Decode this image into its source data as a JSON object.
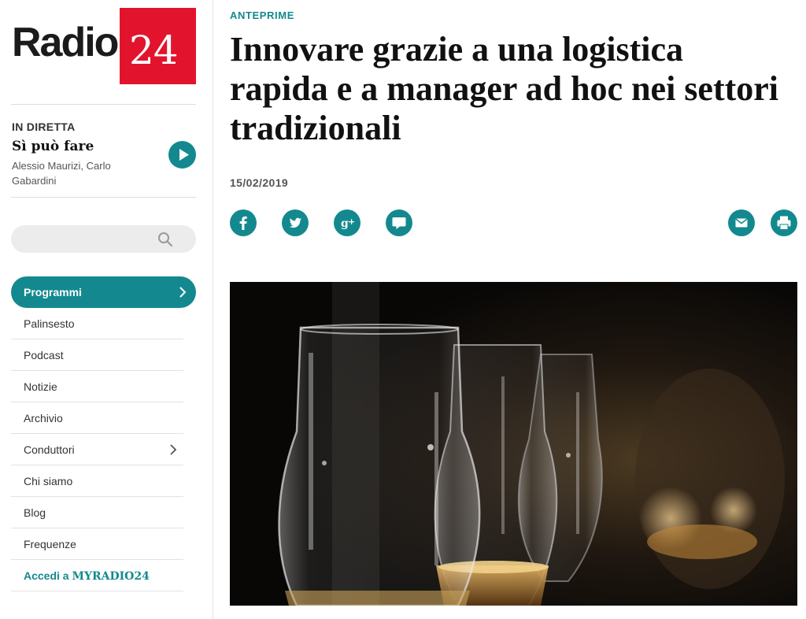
{
  "logo": {
    "word": "Radio",
    "number": "24"
  },
  "live": {
    "label": "IN DIRETTA",
    "show": "Sì può fare",
    "hosts": "Alessio Maurizi, Carlo Gabardini"
  },
  "search": {
    "placeholder": "",
    "icon": "search-icon"
  },
  "nav": {
    "items": [
      {
        "label": "Programmi"
      },
      {
        "label": "Palinsesto"
      },
      {
        "label": "Podcast"
      },
      {
        "label": "Notizie"
      },
      {
        "label": "Archivio"
      },
      {
        "label": "Conduttori"
      },
      {
        "label": "Chi siamo"
      },
      {
        "label": "Blog"
      },
      {
        "label": "Frequenze"
      }
    ],
    "account_prefix": "Accedi a ",
    "account_brand": "MYRADIO24"
  },
  "article": {
    "kicker": "ANTEPRIME",
    "headline": "Innovare grazie a una logistica rapida e a manager ad hoc nei settori tradizionali",
    "date": "15/02/2019"
  },
  "share_icons": [
    "facebook-icon",
    "twitter-icon",
    "google-plus-icon",
    "comment-icon",
    "email-icon",
    "print-icon"
  ],
  "colors": {
    "accent": "#13898f",
    "brand_red": "#e2142d",
    "text": "#111111"
  }
}
